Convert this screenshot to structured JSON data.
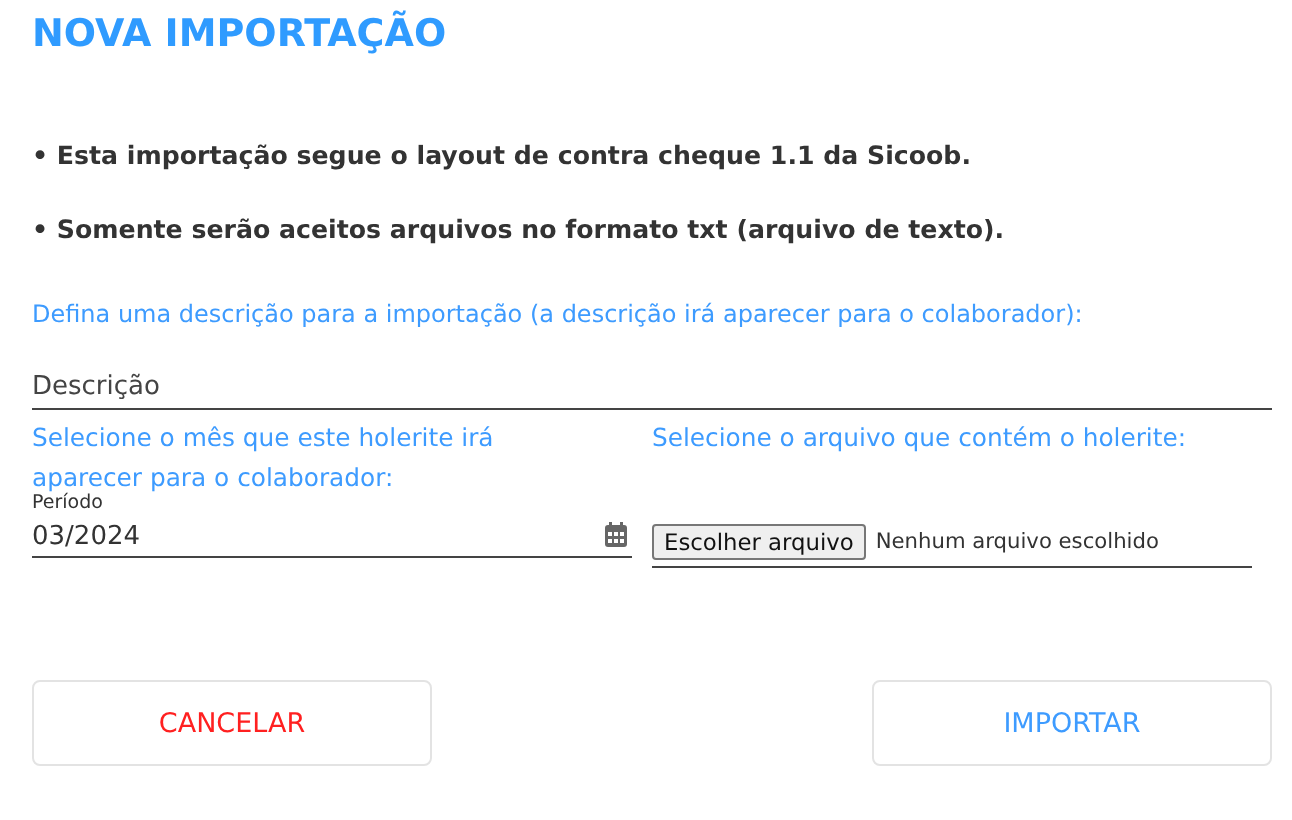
{
  "title": "NOVA IMPORTAÇÃO",
  "notes": [
    "• Esta importação segue o layout de contra cheque 1.1 da Sicoob.",
    "• Somente serão aceitos arquivos no formato txt (arquivo de texto)."
  ],
  "description": {
    "label": "Defina uma descrição para a importação (a descrição irá aparecer para o colaborador):",
    "placeholder": "Descrição"
  },
  "period": {
    "label": "Selecione o mês que este holerite irá aparecer para o colaborador:",
    "field_label": "Período",
    "value": "03/2024"
  },
  "file": {
    "label": "Selecione o arquivo que contém o holerite:",
    "button": "Escolher arquivo",
    "status": "Nenhum arquivo escolhido"
  },
  "buttons": [
    {
      "label": "CANCELAR",
      "kind": "cancel"
    },
    {
      "label": "IMPORTAR",
      "kind": "confirm"
    }
  ]
}
